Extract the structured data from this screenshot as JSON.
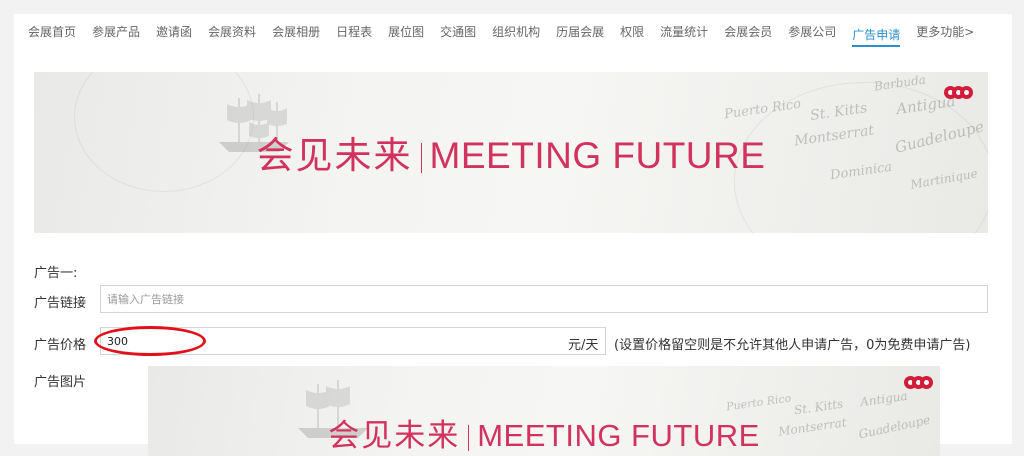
{
  "nav": {
    "items": [
      {
        "label": "会展首页",
        "name": "nav-item-home"
      },
      {
        "label": "参展产品",
        "name": "nav-item-products"
      },
      {
        "label": "邀请函",
        "name": "nav-item-invitation"
      },
      {
        "label": "会展资料",
        "name": "nav-item-materials"
      },
      {
        "label": "会展相册",
        "name": "nav-item-album"
      },
      {
        "label": "日程表",
        "name": "nav-item-schedule"
      },
      {
        "label": "展位图",
        "name": "nav-item-booth-map"
      },
      {
        "label": "交通图",
        "name": "nav-item-traffic-map"
      },
      {
        "label": "组织机构",
        "name": "nav-item-organization"
      },
      {
        "label": "历届会展",
        "name": "nav-item-past-exhibitions"
      },
      {
        "label": "权限",
        "name": "nav-item-permissions"
      },
      {
        "label": "流量统计",
        "name": "nav-item-traffic-stats"
      },
      {
        "label": "会展会员",
        "name": "nav-item-members"
      },
      {
        "label": "参展公司",
        "name": "nav-item-companies"
      },
      {
        "label": "广告申请",
        "name": "nav-item-ad-application"
      },
      {
        "label": "更多功能>",
        "name": "nav-item-more"
      }
    ],
    "active": "广告申请"
  },
  "banner": {
    "title_cn": "会见未来",
    "title_en": "MEETING FUTURE",
    "map_words": [
      "St. Kitts",
      "Antigua",
      "Montserrat",
      "Guadeloupe",
      "Dominica",
      "Martinique",
      "Puerto Rico",
      "Barbuda"
    ]
  },
  "form": {
    "section_title": "广告一:",
    "link_label": "广告链接",
    "link_placeholder": "请输入广告链接",
    "price_label": "广告价格",
    "price_value": "300",
    "price_unit": "元/天",
    "price_hint": "(设置价格留空则是不允许其他人申请广告，0为免费申请广告)",
    "image_label": "广告图片"
  },
  "colors": {
    "accent": "#2a8fd0",
    "banner_title": "#d1335e",
    "logo": "#d21c3a",
    "annotation": "#e2101a"
  }
}
